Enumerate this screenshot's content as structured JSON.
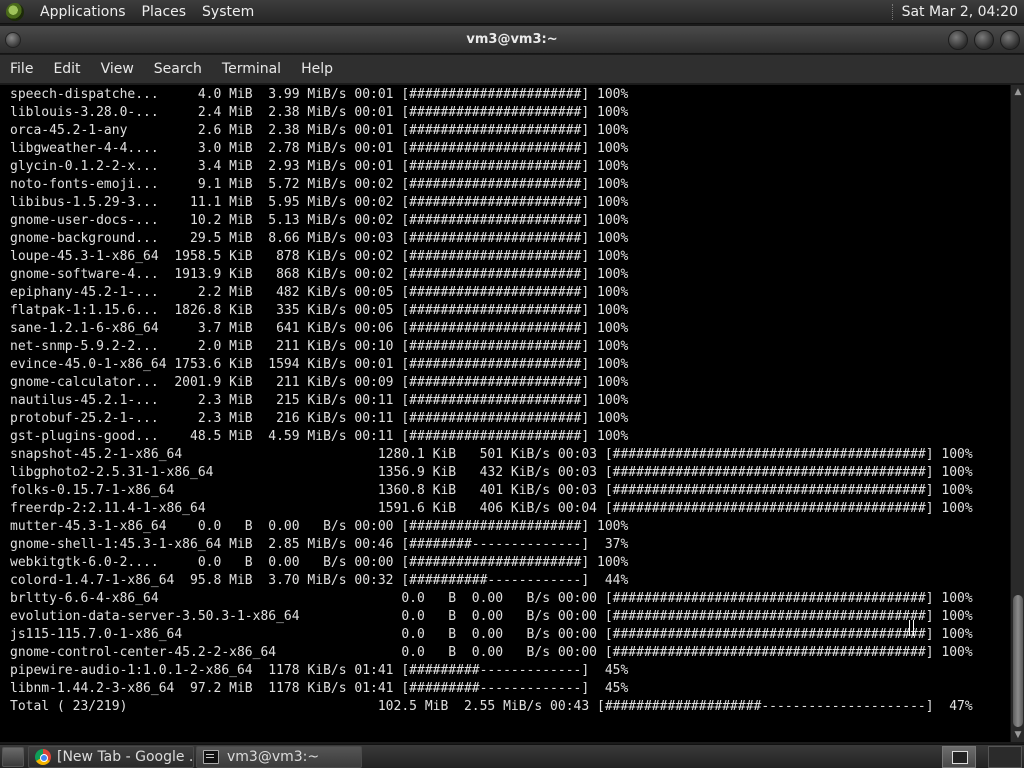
{
  "top_panel": {
    "menus": [
      "Applications",
      "Places",
      "System"
    ],
    "clock": "Sat Mar 2, 04:20"
  },
  "window": {
    "title": "vm3@vm3:~"
  },
  "menubar": {
    "items": [
      "File",
      "Edit",
      "View",
      "Search",
      "Terminal",
      "Help"
    ]
  },
  "terminal": {
    "lines": [
      "speech-dispatche...     4.0 MiB  3.99 MiB/s 00:01 [######################] 100%",
      "liblouis-3.28.0-...     2.4 MiB  2.38 MiB/s 00:01 [######################] 100%",
      "orca-45.2-1-any         2.6 MiB  2.38 MiB/s 00:01 [######################] 100%",
      "libgweather-4-4....     3.0 MiB  2.78 MiB/s 00:01 [######################] 100%",
      "glycin-0.1.2-2-x...     3.4 MiB  2.93 MiB/s 00:01 [######################] 100%",
      "noto-fonts-emoji...     9.1 MiB  5.72 MiB/s 00:02 [######################] 100%",
      "libibus-1.5.29-3...    11.1 MiB  5.95 MiB/s 00:02 [######################] 100%",
      "gnome-user-docs-...    10.2 MiB  5.13 MiB/s 00:02 [######################] 100%",
      "gnome-background...    29.5 MiB  8.66 MiB/s 00:03 [######################] 100%",
      "loupe-45.3-1-x86_64  1958.5 KiB   878 KiB/s 00:02 [######################] 100%",
      "gnome-software-4...  1913.9 KiB   868 KiB/s 00:02 [######################] 100%",
      "epiphany-45.2-1-...     2.2 MiB   482 KiB/s 00:05 [######################] 100%",
      "flatpak-1:1.15.6...  1826.8 KiB   335 KiB/s 00:05 [######################] 100%",
      "sane-1.2.1-6-x86_64     3.7 MiB   641 KiB/s 00:06 [######################] 100%",
      "net-snmp-5.9.2-2...     2.0 MiB   211 KiB/s 00:10 [######################] 100%",
      "evince-45.0-1-x86_64 1753.6 KiB  1594 KiB/s 00:01 [######################] 100%",
      "gnome-calculator...  2001.9 KiB   211 KiB/s 00:09 [######################] 100%",
      "nautilus-45.2.1-...     2.3 MiB   215 KiB/s 00:11 [######################] 100%",
      "protobuf-25.2-1-...     2.3 MiB   216 KiB/s 00:11 [######################] 100%",
      "gst-plugins-good...    48.5 MiB  4.59 MiB/s 00:11 [######################] 100%",
      "snapshot-45.2-1-x86_64                         1280.1 KiB   501 KiB/s 00:03 [########################################] 100%",
      "libgphoto2-2.5.31-1-x86_64                     1356.9 KiB   432 KiB/s 00:03 [########################################] 100%",
      "folks-0.15.7-1-x86_64                          1360.8 KiB   401 KiB/s 00:03 [########################################] 100%",
      "freerdp-2:2.11.4-1-x86_64                      1591.6 KiB   406 KiB/s 00:04 [########################################] 100%",
      "mutter-45.3-1-x86_64    0.0   B  0.00   B/s 00:00 [######################] 100%",
      "gnome-shell-1:45.3-1-x86_64 MiB  2.85 MiB/s 00:46 [########--------------]  37%",
      "webkitgtk-6.0-2....     0.0   B  0.00   B/s 00:00 [######################] 100%",
      "colord-1.4.7-1-x86_64  95.8 MiB  3.70 MiB/s 00:32 [##########------------]  44%",
      "brltty-6.6-4-x86_64                               0.0   B  0.00   B/s 00:00 [########################################] 100%",
      "evolution-data-server-3.50.3-1-x86_64             0.0   B  0.00   B/s 00:00 [########################################] 100%",
      "js115-115.7.0-1-x86_64                            0.0   B  0.00   B/s 00:00 [########################################] 100%",
      "gnome-control-center-45.2-2-x86_64                0.0   B  0.00   B/s 00:00 [########################################] 100%",
      "pipewire-audio-1:1.0.1-2-x86_64  1178 KiB/s 01:41 [#########-------------]  45%",
      "libnm-1.44.2-3-x86_64  97.2 MiB  1178 KiB/s 01:41 [#########-------------]  45%",
      "Total ( 23/219)                                102.5 MiB  2.55 MiB/s 00:43 [####################---------------------]  47%"
    ]
  },
  "taskbar": {
    "tasks": [
      {
        "label": "[New Tab - Google ...",
        "icon": "chrome-icon"
      },
      {
        "label": "vm3@vm3:~",
        "icon": "terminal-icon"
      }
    ]
  },
  "icons": {
    "panel_logo": "distro-logo-icon",
    "window_menu": "window-menu-icon",
    "minimize": "minimize-icon",
    "maximize": "maximize-icon",
    "close": "close-icon"
  }
}
